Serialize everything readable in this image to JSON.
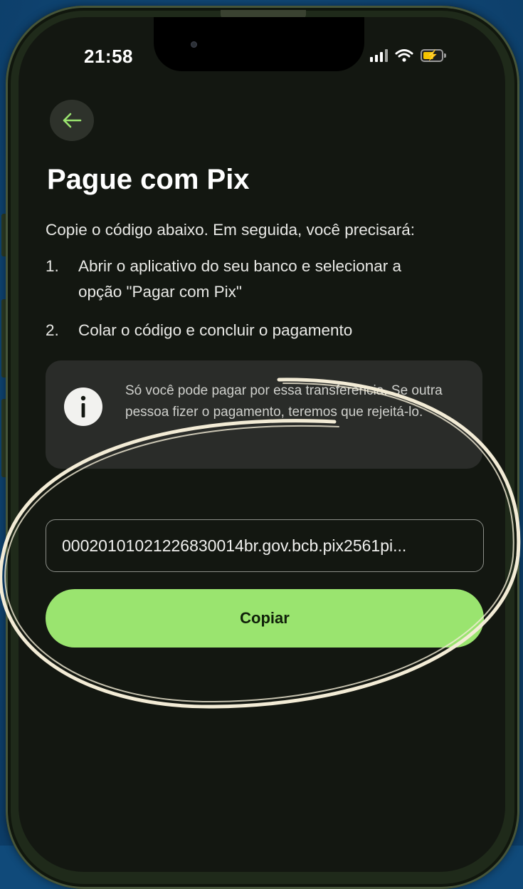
{
  "status_bar": {
    "time": "21:58"
  },
  "header": {
    "back_icon": "arrow-left-icon",
    "title": "Pague com Pix"
  },
  "instructions": {
    "intro": "Copie o código abaixo. Em seguida, você precisará:",
    "steps": [
      {
        "num": "1.",
        "text": "Abrir o aplicativo do seu banco e selecionar a opção \"Pagar com Pix\""
      },
      {
        "num": "2.",
        "text": "Colar o código e concluir o pagamento"
      }
    ]
  },
  "info_notice": {
    "icon": "info-icon",
    "text": "Só você pode pagar por essa transferência. Se outra pessoa fizer o pagamento, teremos que rejeitá-lo."
  },
  "pix_code": {
    "value": "00020101021226830014br.gov.bcb.pix2561pi..."
  },
  "copy_button": {
    "label": "Copiar"
  },
  "colors": {
    "accent_green": "#9ae46f",
    "screen_background": "#131711",
    "page_background": "#104a7a",
    "annotation_stroke": "#f3ecd6"
  }
}
